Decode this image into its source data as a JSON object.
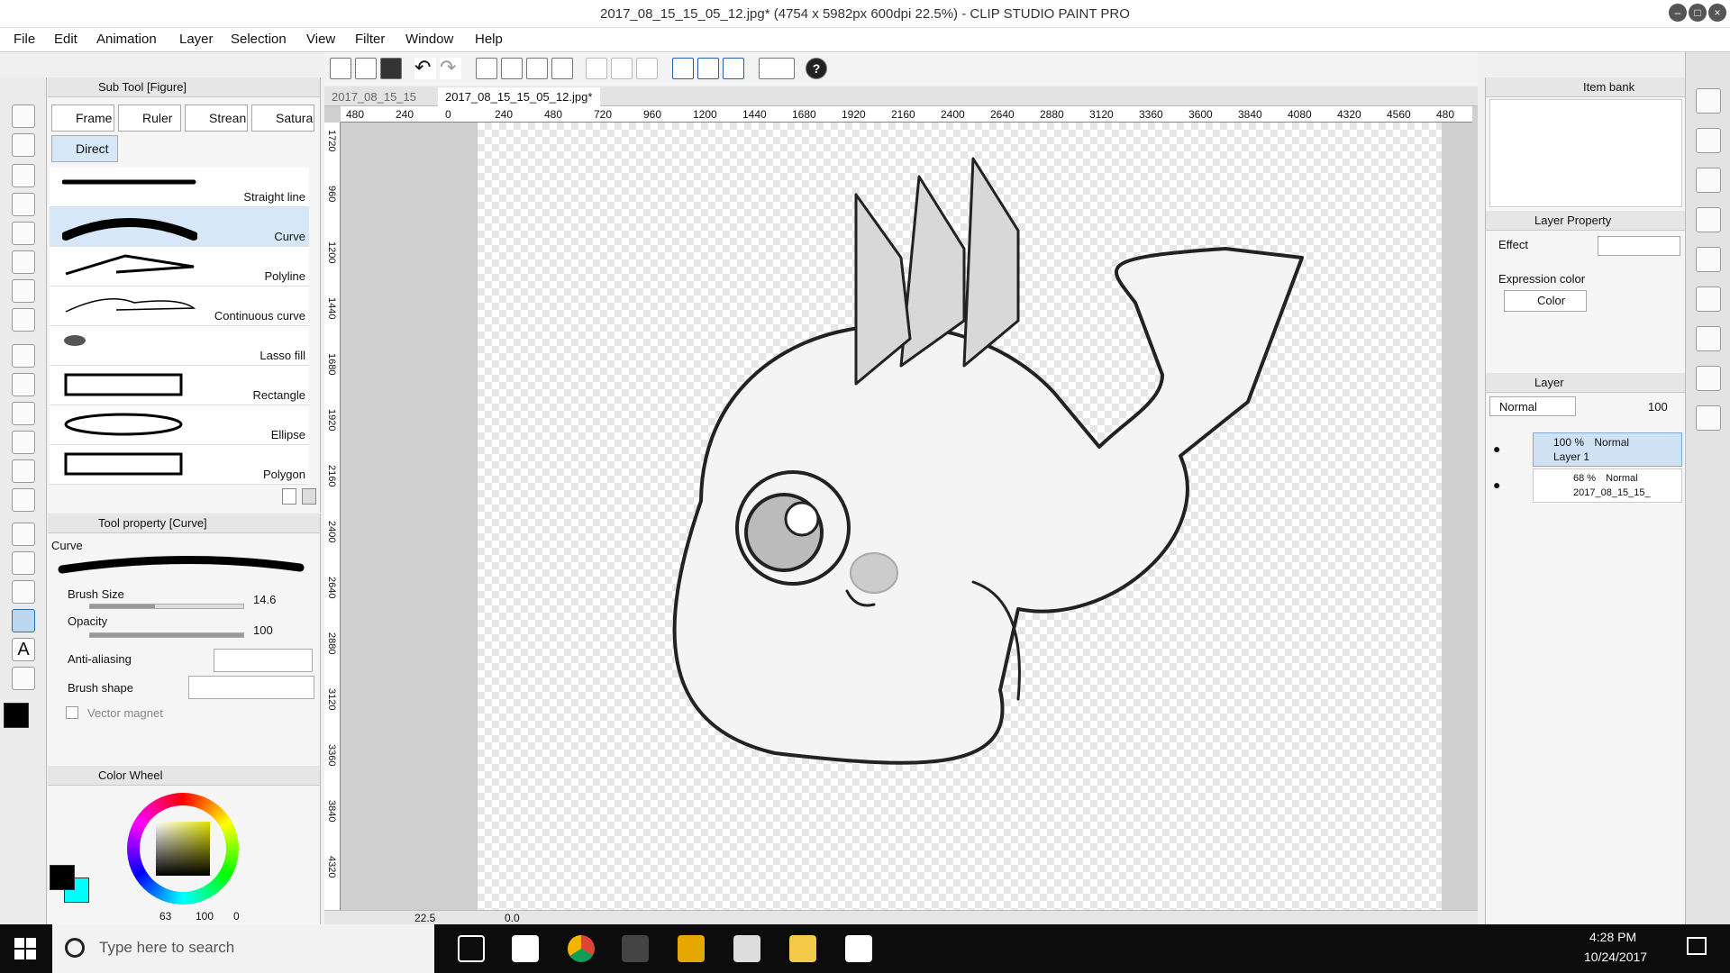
{
  "window": {
    "title": "2017_08_15_15_05_12.jpg* (4754 x 5982px 600dpi 22.5%)  - CLIP STUDIO PAINT PRO"
  },
  "menu": [
    "File",
    "Edit",
    "Animation",
    "Layer",
    "Selection",
    "View",
    "Filter",
    "Window",
    "Help"
  ],
  "subtool": {
    "header": "Sub Tool [Figure]",
    "tabs": [
      "Frame",
      "Ruler",
      "Strean",
      "Satura",
      "Direct"
    ],
    "items": [
      {
        "label": "Straight line"
      },
      {
        "label": "Curve",
        "selected": true
      },
      {
        "label": "Polyline"
      },
      {
        "label": "Continuous curve"
      },
      {
        "label": "Lasso fill"
      },
      {
        "label": "Rectangle"
      },
      {
        "label": "Ellipse"
      },
      {
        "label": "Polygon"
      }
    ]
  },
  "toolprop": {
    "header": "Tool property [Curve]",
    "name": "Curve",
    "brush_size_label": "Brush Size",
    "brush_size_value": "14.6",
    "opacity_label": "Opacity",
    "opacity_value": "100",
    "antialias_label": "Anti-aliasing",
    "brush_shape_label": "Brush shape",
    "vector_magnet_label": "Vector magnet"
  },
  "color": {
    "header": "Color Wheel",
    "h": "63",
    "s": "100",
    "v": "0",
    "main_color": "#000000",
    "sub_color": "#00ffff"
  },
  "document": {
    "tabs": [
      "2017_08_15_15",
      "2017_08_15_15_05_12.jpg*"
    ],
    "zoom": "22.5",
    "rotation": "0.0"
  },
  "ruler_top": [
    "480",
    "240",
    "0",
    "240",
    "480",
    "720",
    "960",
    "1200",
    "1440",
    "1680",
    "1920",
    "2160",
    "2400",
    "2640",
    "2880",
    "3120",
    "3360",
    "3600",
    "3840",
    "4080",
    "4320",
    "4560",
    "480"
  ],
  "ruler_left": [
    "1720",
    "960",
    "1200",
    "1440",
    "1680",
    "1920",
    "2160",
    "2400",
    "2640",
    "2880",
    "3120",
    "3360",
    "3840",
    "4320"
  ],
  "right": {
    "itembank": "Item bank",
    "layer_property": "Layer Property",
    "effect": "Effect",
    "expression_color": "Expression color",
    "color_mode": "Color",
    "layer_tab": "Layer",
    "blend_mode": "Normal",
    "opacity": "100",
    "layers": [
      {
        "percent": "100 %",
        "mode": "Normal",
        "name": "Layer 1",
        "selected": true
      },
      {
        "percent": "68 %",
        "mode": "Normal",
        "name": "2017_08_15_15_"
      }
    ]
  },
  "taskbar": {
    "search_placeholder": "Type here to search",
    "time": "4:28 PM",
    "date": "10/24/2017"
  }
}
